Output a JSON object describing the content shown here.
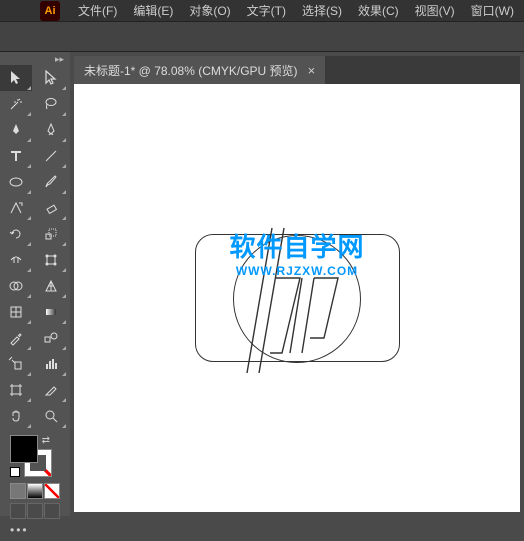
{
  "app": {
    "logo": "Ai"
  },
  "menu": {
    "file": "文件(F)",
    "edit": "编辑(E)",
    "object": "对象(O)",
    "type": "文字(T)",
    "select": "选择(S)",
    "effect": "效果(C)",
    "view": "视图(V)",
    "window": "窗口(W)"
  },
  "tab": {
    "title": "未标题-1* @ 78.08%  (CMYK/GPU 预览)",
    "close": "×"
  },
  "watermark": {
    "title": "软件自学网",
    "url": "WWW.RJZXW.COM"
  },
  "tools": {
    "selection": "selection",
    "direct": "direct-selection",
    "wand": "magic-wand",
    "lasso": "lasso",
    "pen": "pen",
    "curvature": "curvature",
    "type": "type",
    "line": "line-segment",
    "ellipse": "ellipse",
    "brush": "paintbrush",
    "shaper": "shaper",
    "eraser": "eraser",
    "rotate": "rotate",
    "scale": "scale",
    "width": "width",
    "freetransform": "free-transform",
    "shapebuilder": "shape-builder",
    "perspective": "perspective",
    "mesh": "mesh",
    "gradient": "gradient",
    "eyedropper": "eyedropper",
    "blend": "blend",
    "symbolspray": "symbol-sprayer",
    "graph": "column-graph",
    "artboard": "artboard",
    "slice": "slice",
    "hand": "hand",
    "zoom": "zoom"
  }
}
